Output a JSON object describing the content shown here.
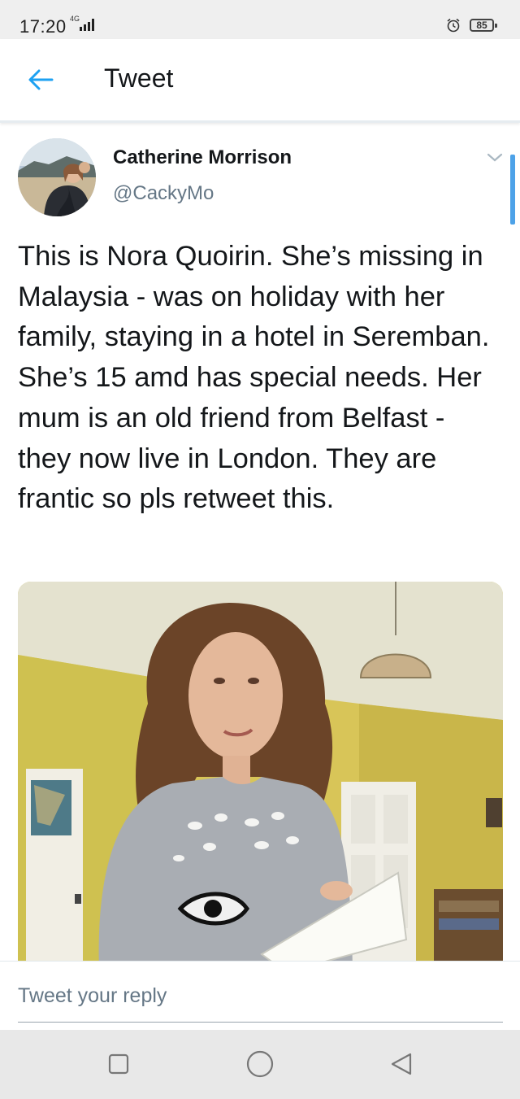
{
  "status_bar": {
    "time": "17:20",
    "network": "4G",
    "battery": "85",
    "icons": [
      "signal-icon",
      "alarm-icon",
      "battery-icon"
    ]
  },
  "app_bar": {
    "title": "Tweet",
    "back_icon": "arrow-left-icon"
  },
  "tweet": {
    "author_name": "Catherine Morrison",
    "author_handle": "@CackyMo",
    "text": "This is Nora Quoirin. She’s missing in Malaysia - was on holiday with her family, staying in a hotel in Seremban. She’s 15 amd has special needs. Her mum is an old friend from Belfast - they now live in London. They are frantic so pls retweet this.",
    "menu_icon": "chevron-down-icon"
  },
  "reply": {
    "placeholder": "Tweet your reply"
  },
  "system_nav": {
    "icons": [
      "recents-square-icon",
      "home-circle-icon",
      "back-triangle-icon"
    ]
  },
  "colors": {
    "accent": "#1da1f2",
    "text": "#14171a",
    "secondary": "#657786",
    "divider": "#e6ecf0"
  }
}
